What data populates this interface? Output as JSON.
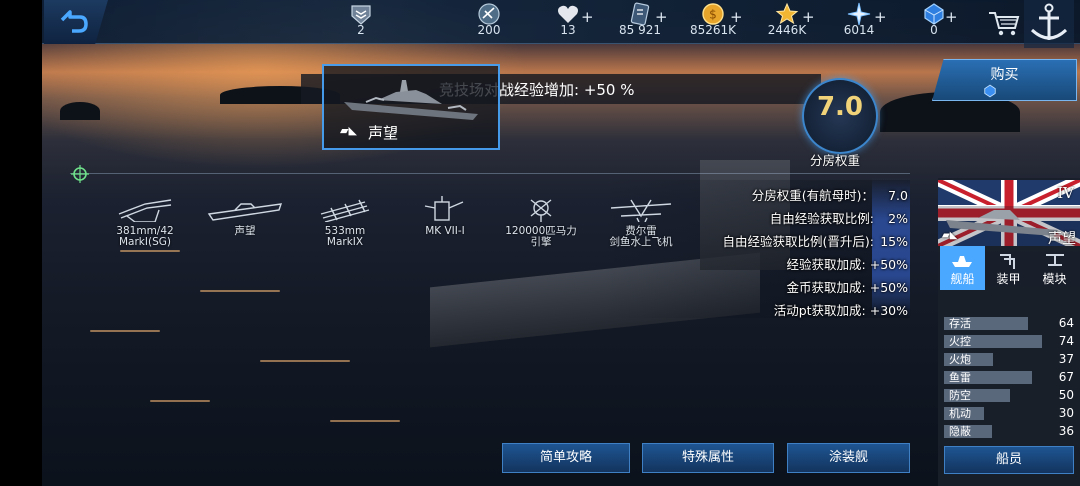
{
  "topbar": {
    "resources": [
      {
        "icon": "rank-badge-icon",
        "value": "2"
      },
      {
        "icon": "steering-wheel-icon",
        "value": "200"
      },
      {
        "icon": "heart-icon",
        "value": "13"
      },
      {
        "icon": "blueprint-card-icon",
        "value": "85 921"
      },
      {
        "icon": "gold-coin-icon",
        "value": "85261K"
      },
      {
        "icon": "star-icon",
        "value": "2446K"
      },
      {
        "icon": "sparkle-star-icon",
        "value": "6014"
      },
      {
        "icon": "blue-gem-icon",
        "value": "0"
      }
    ],
    "plus": "+"
  },
  "ship_card": {
    "bonus_text": "竞技场对战经验增加:  +50 %",
    "ship_name": "声望",
    "tier_marker": "▰◣"
  },
  "rating": {
    "value": "7.0",
    "label": "分房权重"
  },
  "buy": {
    "label": "购买"
  },
  "stats": [
    {
      "label": "分房权重(有航母时)：",
      "value": "7.0"
    },
    {
      "label": "自由经验获取比例:",
      "value": "2%"
    },
    {
      "label": "自由经验获取比例(晋升后):",
      "value": "15%"
    },
    {
      "label": "经验获取加成:",
      "value": "+50%"
    },
    {
      "label": "金币获取加成:",
      "value": "+50%"
    },
    {
      "label": "活动pt获取加成:",
      "value": "+30%"
    }
  ],
  "weapons": [
    {
      "icon": "main-gun-icon",
      "lines": [
        "381mm/42",
        "MarkI(SG)"
      ]
    },
    {
      "icon": "secondary-ship-icon",
      "lines": [
        "声望",
        ""
      ]
    },
    {
      "icon": "torpedo-icon",
      "lines": [
        "533mm",
        "MarkIX"
      ]
    },
    {
      "icon": "radar-icon",
      "lines": [
        "MK VII-I",
        ""
      ]
    },
    {
      "icon": "engine-icon",
      "lines": [
        "120000匹马力",
        "引擎"
      ]
    },
    {
      "icon": "seaplane-icon",
      "lines": [
        "费尔雷",
        "剑鱼水上飞机"
      ]
    }
  ],
  "bottom_buttons": [
    "简单攻略",
    "特殊属性",
    "涂装舰"
  ],
  "side_panel": {
    "tier": "IV",
    "ship_name": "声望",
    "tabs": [
      {
        "label": "舰船",
        "icon": "ship-tab-icon"
      },
      {
        "label": "装甲",
        "icon": "armor-tab-icon"
      },
      {
        "label": "模块",
        "icon": "module-tab-icon"
      }
    ],
    "attributes": [
      {
        "label": "存活",
        "value": "64"
      },
      {
        "label": "火控",
        "value": "74"
      },
      {
        "label": "火炮",
        "value": "37"
      },
      {
        "label": "鱼雷",
        "value": "67"
      },
      {
        "label": "防空",
        "value": "50"
      },
      {
        "label": "机动",
        "value": "30"
      },
      {
        "label": "隐蔽",
        "value": "36"
      }
    ],
    "crew_button": "船员"
  },
  "colors": {
    "accent_blue": "#3f7fc4",
    "rating_gold": "#f1d47a",
    "highlight_cyan": "#4aa8ff"
  }
}
